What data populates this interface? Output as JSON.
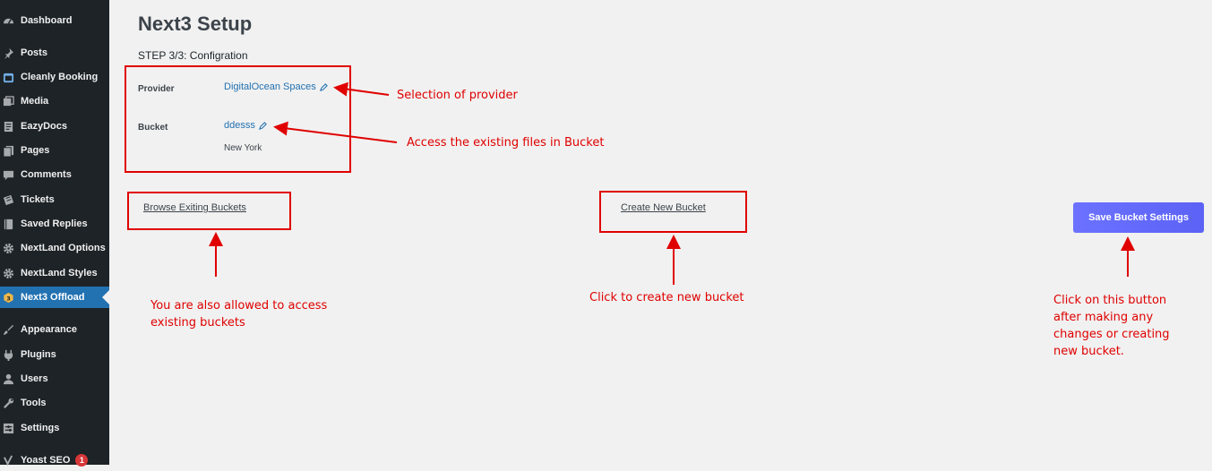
{
  "sidebar": {
    "items": [
      {
        "label": "Dashboard",
        "icon": "dashboard-icon"
      },
      {
        "label": "Posts",
        "icon": "pin-icon"
      },
      {
        "label": "Cleanly Booking",
        "icon": "booking-icon"
      },
      {
        "label": "Media",
        "icon": "media-icon"
      },
      {
        "label": "EazyDocs",
        "icon": "docs-icon"
      },
      {
        "label": "Pages",
        "icon": "pages-icon"
      },
      {
        "label": "Comments",
        "icon": "comment-icon"
      },
      {
        "label": "Tickets",
        "icon": "ticket-icon"
      },
      {
        "label": "Saved Replies",
        "icon": "book-icon"
      },
      {
        "label": "NextLand Options",
        "icon": "gear-icon"
      },
      {
        "label": "NextLand Styles",
        "icon": "gear-icon"
      },
      {
        "label": "Next3 Offload",
        "icon": "next3-logo-icon"
      },
      {
        "label": "Appearance",
        "icon": "brush-icon"
      },
      {
        "label": "Plugins",
        "icon": "plugin-icon"
      },
      {
        "label": "Users",
        "icon": "user-icon"
      },
      {
        "label": "Tools",
        "icon": "wrench-icon"
      },
      {
        "label": "Settings",
        "icon": "settings-icon"
      },
      {
        "label": "Yoast SEO",
        "icon": "yoast-icon",
        "badge": "1"
      }
    ]
  },
  "page": {
    "title": "Next3 Setup",
    "step": "STEP 3/3: Configration"
  },
  "provider": {
    "label": "Provider",
    "value": "DigitalOcean Spaces"
  },
  "bucket": {
    "label": "Bucket",
    "value": "ddesss",
    "region": "New York"
  },
  "actions": {
    "browse": "Browse Exiting Buckets",
    "create": "Create New Bucket",
    "save": "Save Bucket Settings"
  },
  "annotations": {
    "provider": "Selection of provider",
    "bucket": "Access the existing files in Bucket",
    "browse_line1": "You are also allowed to access",
    "browse_line2": "existing buckets",
    "create": "Click to create new bucket",
    "save_line1": "Click on this button",
    "save_line2": "after making any",
    "save_line3": "changes or creating",
    "save_line4": "new bucket."
  },
  "colors": {
    "sidebar": "#1d2327",
    "active": "#2271b1",
    "annotation": "#e00000",
    "save_button": "#6c72ff"
  }
}
